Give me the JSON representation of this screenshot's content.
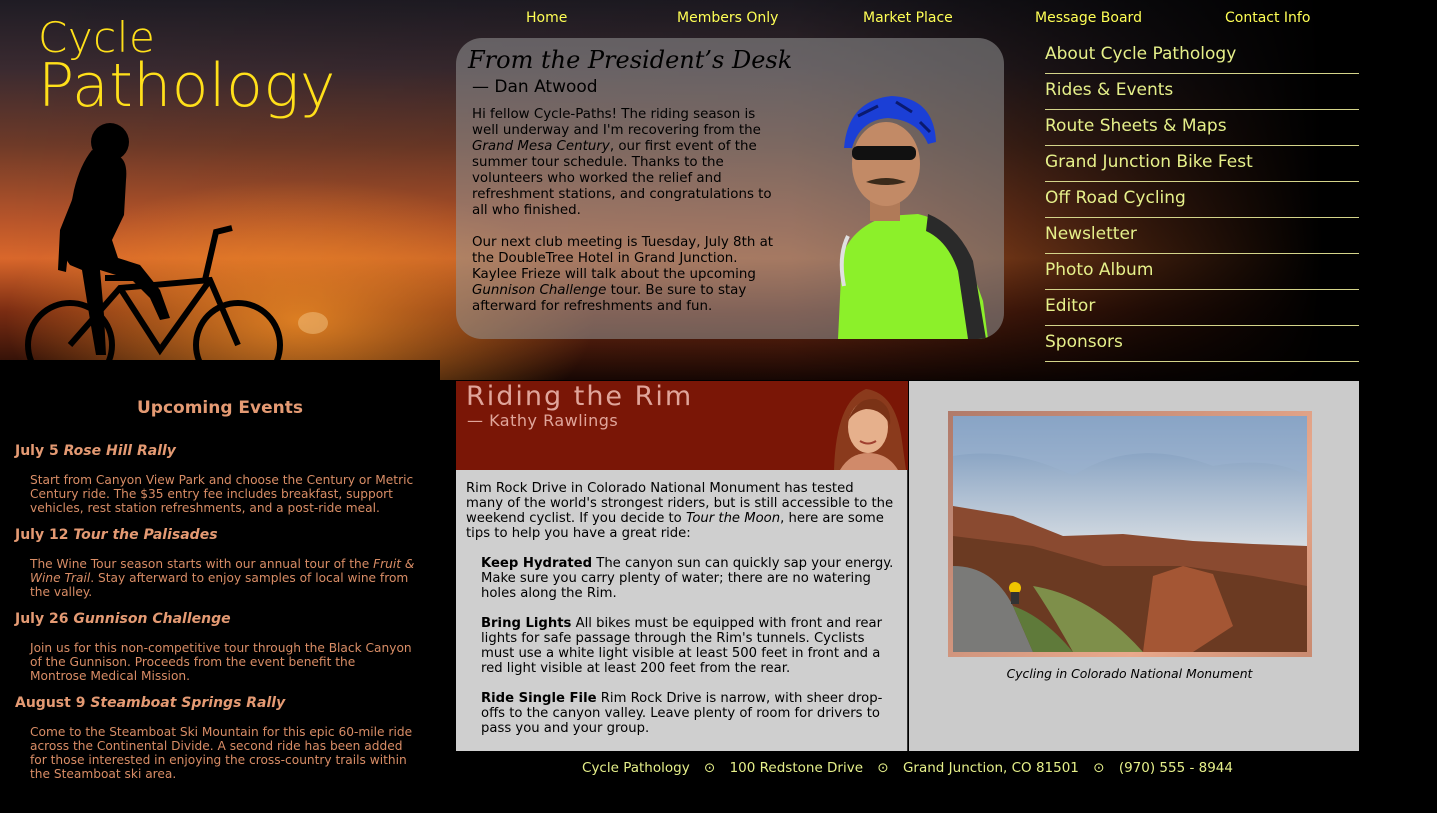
{
  "site": {
    "logo_line1": "Cycle",
    "logo_line2": "Pathology"
  },
  "topnav": [
    {
      "label": "Home"
    },
    {
      "label": "Members Only"
    },
    {
      "label": "Market Place"
    },
    {
      "label": "Message Board"
    },
    {
      "label": "Contact Info"
    }
  ],
  "president": {
    "title": "From the President’s Desk",
    "author": "— Dan Atwood",
    "p1_a": "Hi fellow Cycle-Paths! The riding season is well underway and I'm recovering from the ",
    "p1_em": "Grand Mesa Century",
    "p1_b": ", our first event of the summer tour schedule. Thanks to the volunteers who worked the relief and refreshment stations, and congratulations to all who finished.",
    "p2_a": "Our next club meeting is Tuesday, July 8th at the DoubleTree Hotel in Grand Junction. Kaylee Frieze will talk about the upcoming ",
    "p2_em": "Gunnison Challenge",
    "p2_b": " tour. Be sure to stay afterward for refreshments and fun."
  },
  "sidenav": [
    {
      "label": "About Cycle Pathology"
    },
    {
      "label": "Rides & Events"
    },
    {
      "label": "Route Sheets & Maps"
    },
    {
      "label": "Grand Junction Bike Fest"
    },
    {
      "label": "Off Road Cycling"
    },
    {
      "label": "Newsletter"
    },
    {
      "label": "Photo Album"
    },
    {
      "label": "Editor"
    },
    {
      "label": "Sponsors"
    }
  ],
  "events": {
    "title": "Upcoming Events",
    "items": [
      {
        "date": "July 5 ",
        "name": "Rose Hill Rally",
        "desc_a": "Start from Canyon View Park and choose the Century or Metric Century ride. The $35 entry fee includes breakfast, support vehicles, rest station refreshments, and a post-ride meal.",
        "desc_em": "",
        "desc_b": ""
      },
      {
        "date": "July 12 ",
        "name": "Tour the Palisades",
        "desc_a": "The Wine Tour season starts with our annual tour of the ",
        "desc_em": "Fruit & Wine Trail",
        "desc_b": ". Stay afterward to enjoy samples of local wine from the valley."
      },
      {
        "date": "July 26 ",
        "name": "Gunnison Challenge",
        "desc_a": "Join us for this non-competitive tour through the Black Canyon of the Gunnison. Proceeds from the event benefit the Montrose Medical Mission.",
        "desc_em": "",
        "desc_b": ""
      },
      {
        "date": "August 9 ",
        "name": "Steamboat Springs Rally",
        "desc_a": "Come to the Steamboat Ski Mountain for this epic 60-mile ride across the Continental Divide. A second ride has been added for those interested in enjoying the cross-country trails within the Steamboat ski area.",
        "desc_em": "",
        "desc_b": ""
      }
    ]
  },
  "article": {
    "title": "Riding the Rim",
    "author": "— Kathy Rawlings",
    "intro_a": "Rim Rock Drive in Colorado National Monument has tested many of the world's strongest riders, but is still accessible to the weekend cyclist. If you decide to ",
    "intro_em": "Tour the Moon",
    "intro_b": ", here are some tips to help you have a great ride:",
    "tips": [
      {
        "title": "Keep Hydrated",
        "text": " The canyon sun can quickly sap your energy. Make sure you carry plenty of water; there are no watering holes along the Rim."
      },
      {
        "title": "Bring Lights",
        "text": " All bikes must be equipped with front and rear lights for safe passage through the Rim's tunnels. Cyclists must use a white light visible at least 500 feet in front and a red light visible at least 200 feet from the rear."
      },
      {
        "title": "Ride Single File",
        "text": " Rim Rock Drive is narrow, with sheer drop-offs to the canyon valley. Leave plenty of room for drivers to pass you and your group."
      }
    ]
  },
  "photo": {
    "caption": "Cycling in Colorado National Monument"
  },
  "footer": {
    "name": "Cycle Pathology",
    "address": "100 Redstone Drive",
    "city": "Grand Junction, CO 81501",
    "phone": "(970) 555 - 8944",
    "separator": "⊙"
  },
  "colors": {
    "nav_yellow": "#ffff55",
    "link_green": "#e6f08a",
    "event_orange": "#e49a73",
    "article_red": "#7a1606"
  }
}
